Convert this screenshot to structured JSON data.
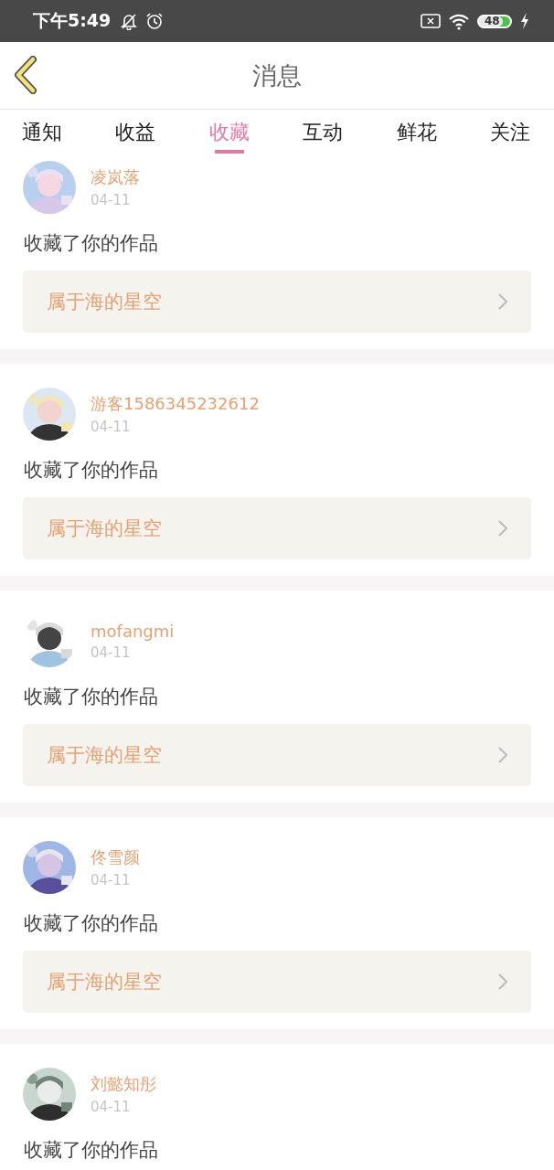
{
  "status_bar": {
    "time": "下午5:49",
    "battery": "48"
  },
  "header": {
    "title": "消息"
  },
  "tabs": [
    {
      "label": "通知",
      "selected": false
    },
    {
      "label": "收益",
      "selected": false
    },
    {
      "label": "收藏",
      "selected": true
    },
    {
      "label": "互动",
      "selected": false
    },
    {
      "label": "鲜花",
      "selected": false
    },
    {
      "label": "关注",
      "selected": false
    }
  ],
  "messages": [
    {
      "user": "凌岚落",
      "date": "04-11",
      "action": "收藏了你的作品",
      "work": "属于海的星空"
    },
    {
      "user": "游客1586345232612",
      "date": "04-11",
      "action": "收藏了你的作品",
      "work": "属于海的星空"
    },
    {
      "user": "mofangmi",
      "date": "04-11",
      "action": "收藏了你的作品",
      "work": "属于海的星空"
    },
    {
      "user": "佟雪颜",
      "date": "04-11",
      "action": "收藏了你的作品",
      "work": "属于海的星空"
    },
    {
      "user": "刘懿知彤",
      "date": "04-11",
      "action": "收藏了你的作品"
    }
  ]
}
